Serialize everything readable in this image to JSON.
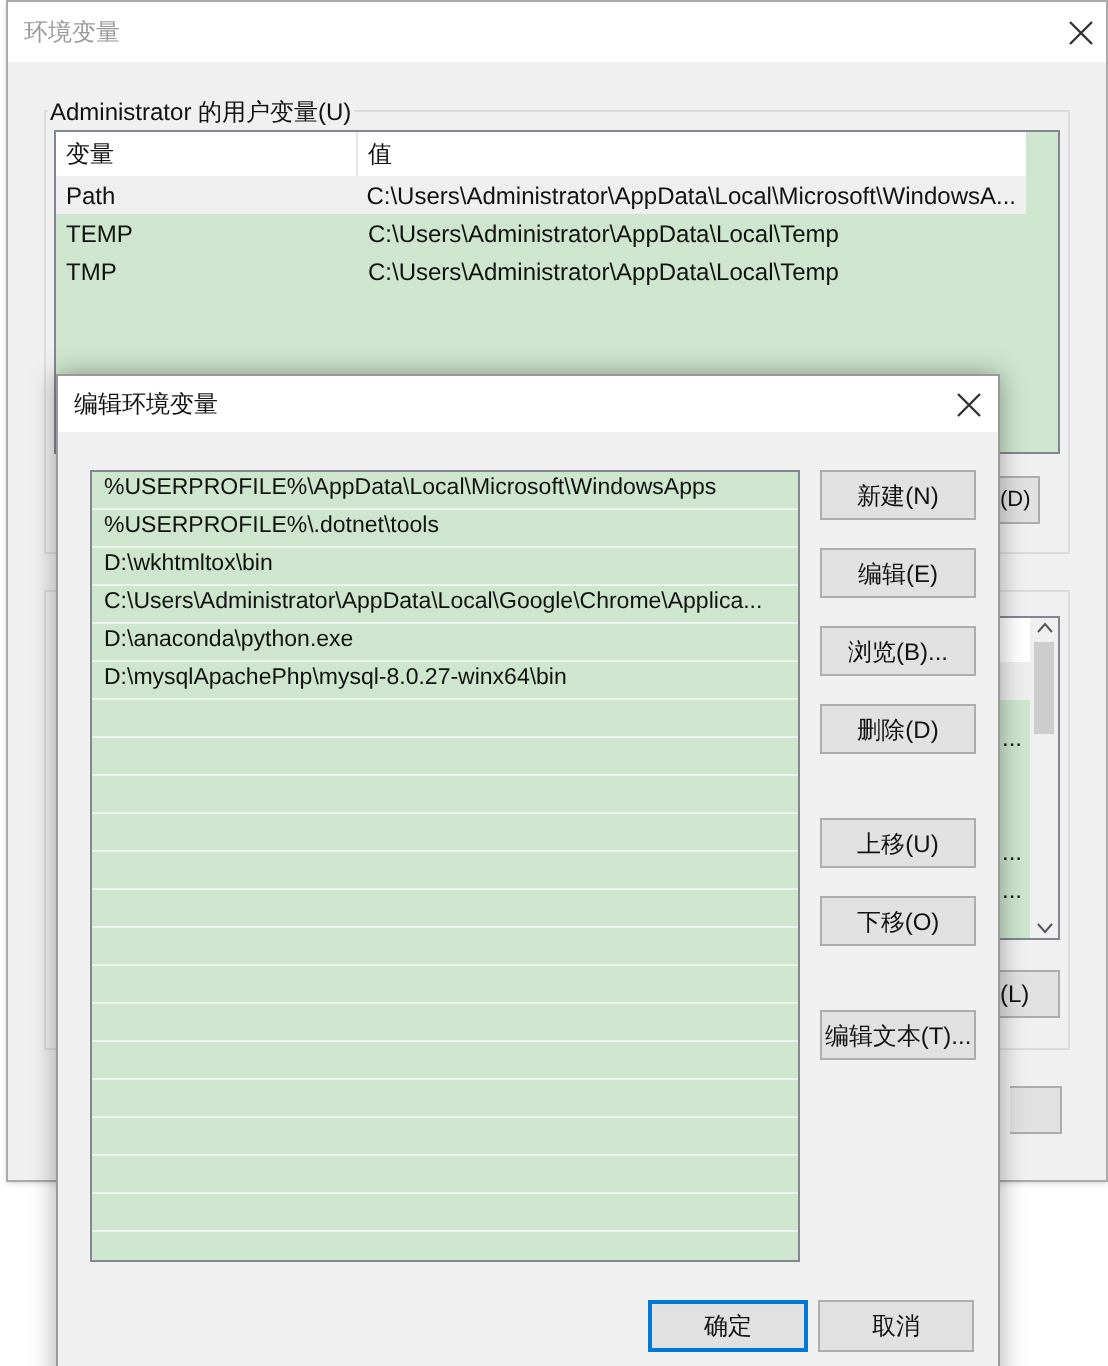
{
  "window": {
    "title": "环境变量"
  },
  "user_variables": {
    "label": "Administrator 的用户变量(U)",
    "columns": [
      "变量",
      "值"
    ],
    "rows": [
      {
        "name": "Path",
        "value": "C:\\Users\\Administrator\\AppData\\Local\\Microsoft\\WindowsA...",
        "selected": true
      },
      {
        "name": "TEMP",
        "value": "C:\\Users\\Administrator\\AppData\\Local\\Temp",
        "selected": false
      },
      {
        "name": "TMP",
        "value": "C:\\Users\\Administrator\\AppData\\Local\\Temp",
        "selected": false
      }
    ],
    "button_fragment": "(D)"
  },
  "system_variables": {
    "row_fragments": [
      "...",
      "...",
      "..."
    ],
    "button_fragment": "(L)"
  },
  "dialog": {
    "title": "编辑环境变量",
    "entries": [
      "%USERPROFILE%\\AppData\\Local\\Microsoft\\WindowsApps",
      "%USERPROFILE%\\.dotnet\\tools",
      "D:\\wkhtmltox\\bin",
      "C:\\Users\\Administrator\\AppData\\Local\\Google\\Chrome\\Applica...",
      "D:\\anaconda\\python.exe",
      "D:\\mysqlApachePhp\\mysql-8.0.27-winx64\\bin"
    ],
    "side_button_groups": [
      [
        "新建(N)",
        "编辑(E)",
        "浏览(B)...",
        "删除(D)"
      ],
      [
        "上移(U)",
        "下移(O)"
      ],
      [
        "编辑文本(T)..."
      ]
    ],
    "footer_buttons": [
      {
        "label": "确定",
        "default": true
      },
      {
        "label": "取消",
        "default": false
      }
    ]
  }
}
